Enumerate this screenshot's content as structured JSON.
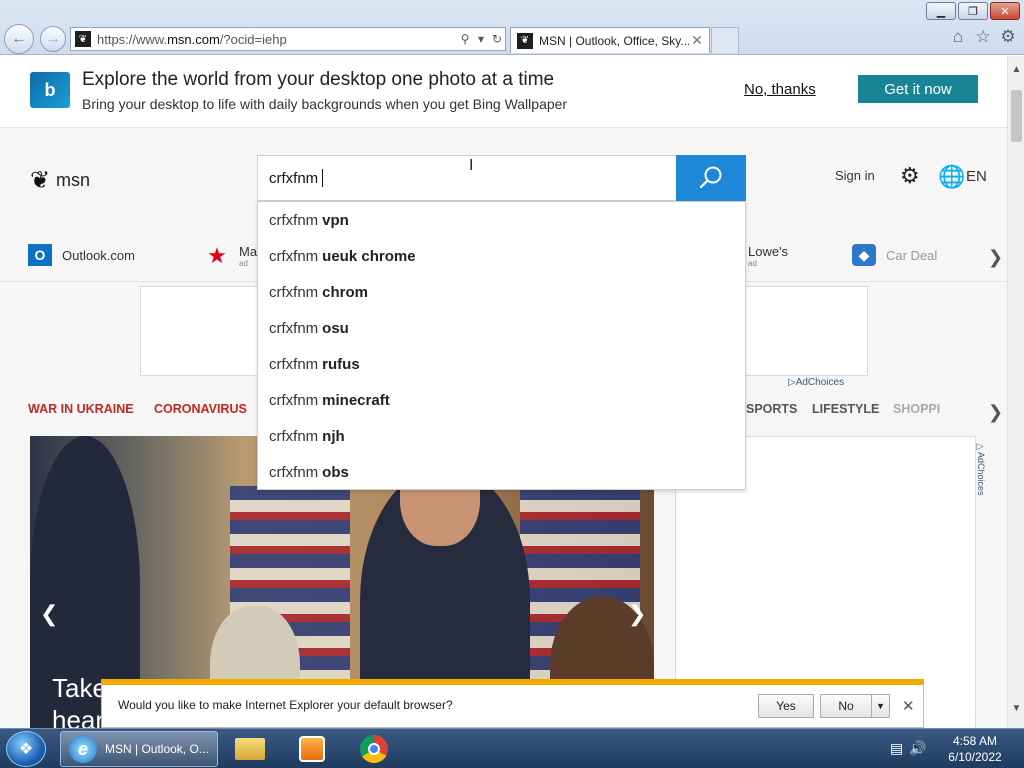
{
  "window": {
    "minimize": "▁",
    "maximize": "❐",
    "close": "✕"
  },
  "browser": {
    "address_prefix": "https://www.",
    "address_domain": "msn.com",
    "address_suffix": "/?ocid=iehp",
    "tab_title": "MSN | Outlook, Office, Sky...",
    "tab_close": "✕"
  },
  "banner": {
    "logo": "b",
    "title": "Explore the world from your desktop one photo at a time",
    "subtitle": "Bring your desktop to life with daily backgrounds when you get Bing Wallpaper",
    "dismiss": "No, thanks",
    "cta": "Get it now"
  },
  "header": {
    "logo_text": "msn",
    "sign_in": "Sign in",
    "language": "EN"
  },
  "search": {
    "query": "crfxfnm",
    "suggestions": [
      {
        "prefix": "crfxfnm",
        "completion": "vpn"
      },
      {
        "prefix": "crfxfnm",
        "completion": "ueuk chrome"
      },
      {
        "prefix": "crfxfnm",
        "completion": "chrom"
      },
      {
        "prefix": "crfxfnm",
        "completion": "osu"
      },
      {
        "prefix": "crfxfnm",
        "completion": "rufus"
      },
      {
        "prefix": "crfxfnm",
        "completion": "minecraft"
      },
      {
        "prefix": "crfxfnm",
        "completion": "njh"
      },
      {
        "prefix": "crfxfnm",
        "completion": "obs"
      }
    ]
  },
  "quicklinks": {
    "outlook": "Outlook.com",
    "macys": "Mac",
    "macys_brand": "macys",
    "macys_ad": "ad",
    "lowes": "Lowe's",
    "lowes_ad": "ad",
    "cardeals": "Car Deal"
  },
  "ads": {
    "adchoices": "AdChoices"
  },
  "categories": {
    "ukraine": "WAR IN UKRAINE",
    "coronavirus": "CORONAVIRUS",
    "sports": "SPORTS",
    "lifestyle": "LIFESTYLE",
    "shopping": "SHOPPI"
  },
  "hero": {
    "caption_line1": "Take",
    "caption_line2": "hear"
  },
  "prompt": {
    "text": "Would you like to make Internet Explorer your default browser?",
    "yes": "Yes",
    "no": "No"
  },
  "taskbar": {
    "ie_label": "MSN | Outlook, O...",
    "time": "4:58 AM",
    "date": "6/10/2022"
  },
  "colors": {
    "accent_teal": "#188495",
    "search_blue": "#1e88d8",
    "category_red": "#c2281d",
    "prompt_bar": "#f2a900"
  }
}
